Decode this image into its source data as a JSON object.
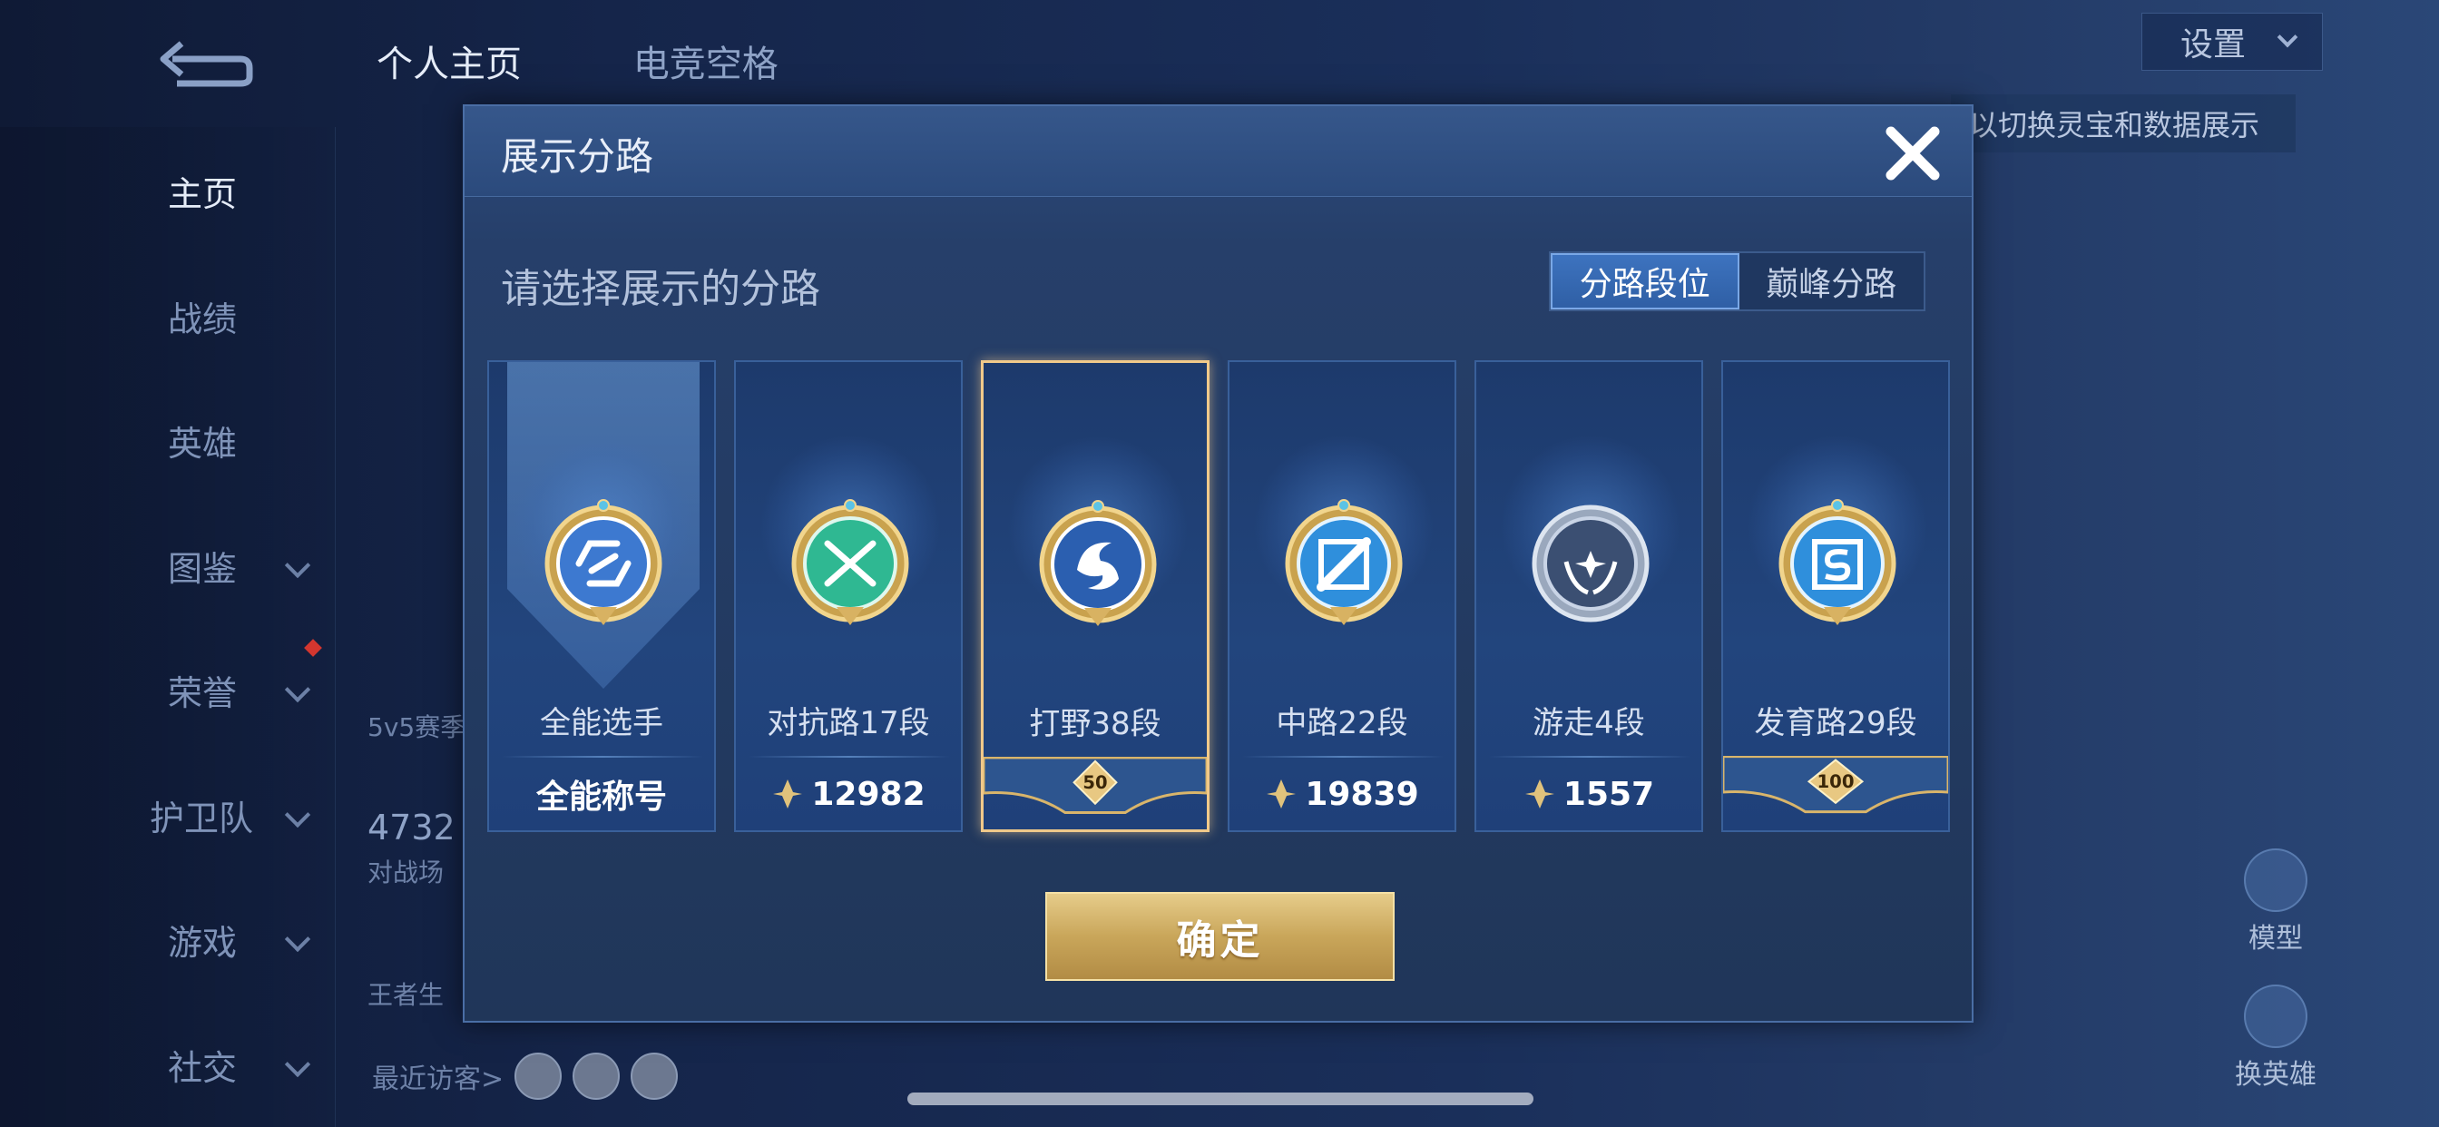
{
  "background": {
    "tabs": [
      "个人主页",
      "电竞空格"
    ],
    "sidebar": [
      {
        "label": "主页",
        "active": true,
        "chevron": false
      },
      {
        "label": "战绩",
        "active": false,
        "chevron": false
      },
      {
        "label": "英雄",
        "active": false,
        "chevron": false
      },
      {
        "label": "图鉴",
        "active": false,
        "chevron": true
      },
      {
        "label": "荣誉",
        "active": false,
        "chevron": true
      },
      {
        "label": "护卫队",
        "active": false,
        "chevron": true
      },
      {
        "label": "游戏",
        "active": false,
        "chevron": true
      },
      {
        "label": "社交",
        "active": false,
        "chevron": true
      }
    ],
    "settings_label": "设置",
    "hint_text": "以切换灵宝和数据展示",
    "left_stats": [
      "5v5赛季",
      "4732",
      "对战场",
      "王者生"
    ],
    "visitors_label": "最近访客>",
    "right_buttons": [
      "模型",
      "换英雄"
    ]
  },
  "dialog": {
    "title": "展示分路",
    "subtitle": "请选择展示的分路",
    "segments": [
      {
        "label": "分路段位",
        "active": true
      },
      {
        "label": "巅峰分路",
        "active": false
      }
    ],
    "cards": [
      {
        "name": "全能选手",
        "value": "全能称号",
        "kind": "title",
        "emblem_icon": "allround-emblem-icon",
        "highlight_banner": true,
        "selected": false
      },
      {
        "name": "对抗路17段",
        "value": "12982",
        "kind": "score",
        "emblem_icon": "clash-lane-emblem-icon",
        "selected": false
      },
      {
        "name": "打野38段",
        "value": "50",
        "kind": "rank",
        "emblem_icon": "jungle-emblem-icon",
        "selected": true
      },
      {
        "name": "中路22段",
        "value": "19839",
        "kind": "score",
        "emblem_icon": "mid-lane-emblem-icon",
        "selected": false
      },
      {
        "name": "游走4段",
        "value": "1557",
        "kind": "score",
        "emblem_icon": "roam-emblem-icon",
        "selected": false
      },
      {
        "name": "发育路29段",
        "value": "100",
        "kind": "rank",
        "emblem_icon": "farm-lane-emblem-icon",
        "selected": false
      }
    ],
    "confirm_label": "确定"
  },
  "colors": {
    "gold": "#d9b56b",
    "selected_border": "#f0c98a",
    "segment_active": "#3d73bf",
    "card_bg": "#1f3f76"
  }
}
